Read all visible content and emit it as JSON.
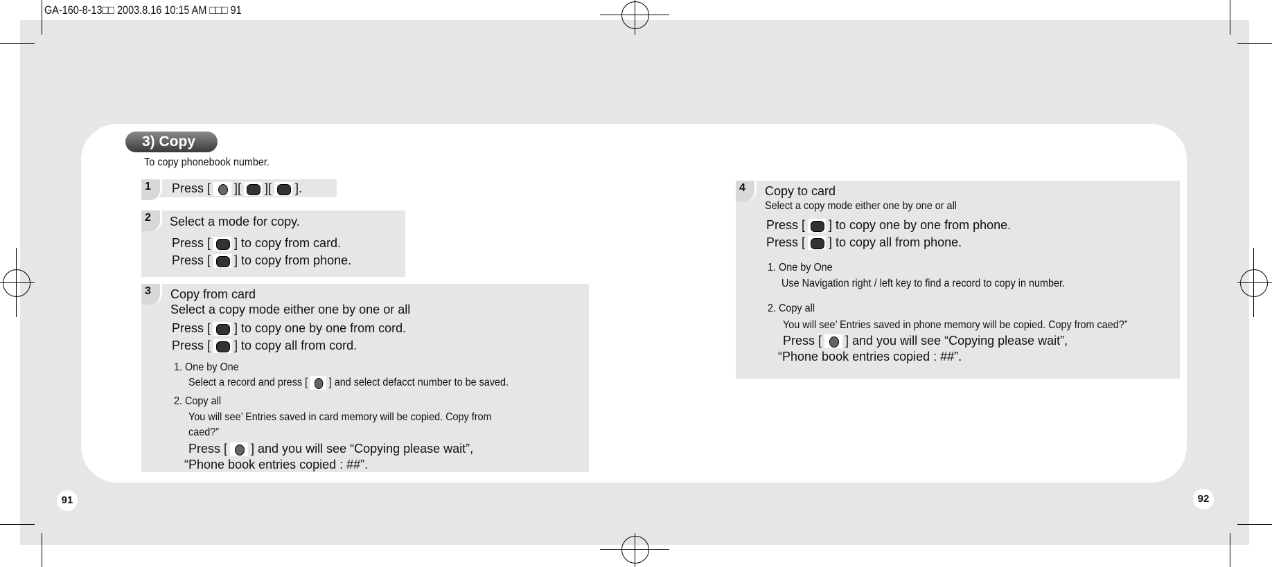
{
  "header": "GA-160-8-13□□  2003.8.16 10:15 AM □□□ 91",
  "title": "3) Copy",
  "intro": "To copy phonebook number.",
  "step1": {
    "num": "1",
    "pre": "Press [",
    "mid1": "][",
    "mid2": "][",
    "post": "]."
  },
  "step2": {
    "num": "2",
    "title": "Select a mode for copy.",
    "l1": "] to copy from card.",
    "l2": "] to copy from phone.",
    "press": "Press ["
  },
  "step3": {
    "num": "3",
    "title": "Copy from card",
    "sub": "Select a copy mode either one by one or all",
    "press": "Press [",
    "l1": "] to copy one by one from cord.",
    "l2": "] to copy all from cord.",
    "h1": "1. One by One",
    "h1a": "Select a record and press [",
    "h1b": "] and select defacct number to be saved.",
    "h2": "2. Copy all",
    "h2a": "You will see’  Entries saved in card memory will be copied. Copy from",
    "h2b": "caed?”",
    "h2c": "] and you will see “Copying please wait”,",
    "h2d": "“Phone book entries copied : ##”."
  },
  "step4": {
    "num": "4",
    "title": "Copy to card",
    "sub": "Select a copy mode either one by one or all",
    "press": "Press [",
    "l1": "] to copy one by one from phone.",
    "l2": "] to copy all from phone.",
    "h1": "1. One by One",
    "h1a": "Use Navigation right / left key to find a record to copy in number.",
    "h2": "2. Copy all",
    "h2a": "You will see’  Entries saved in phone memory will be copied. Copy from caed?”",
    "h2c": "] and you will see “Copying please wait”,",
    "h2d": "“Phone book entries copied : ##”."
  },
  "pages": {
    "left": "91",
    "right": "92"
  },
  "icons": [
    "ok-key-icon",
    "key-4-icon",
    "key-3-icon",
    "key-1-icon",
    "key-2-icon"
  ]
}
